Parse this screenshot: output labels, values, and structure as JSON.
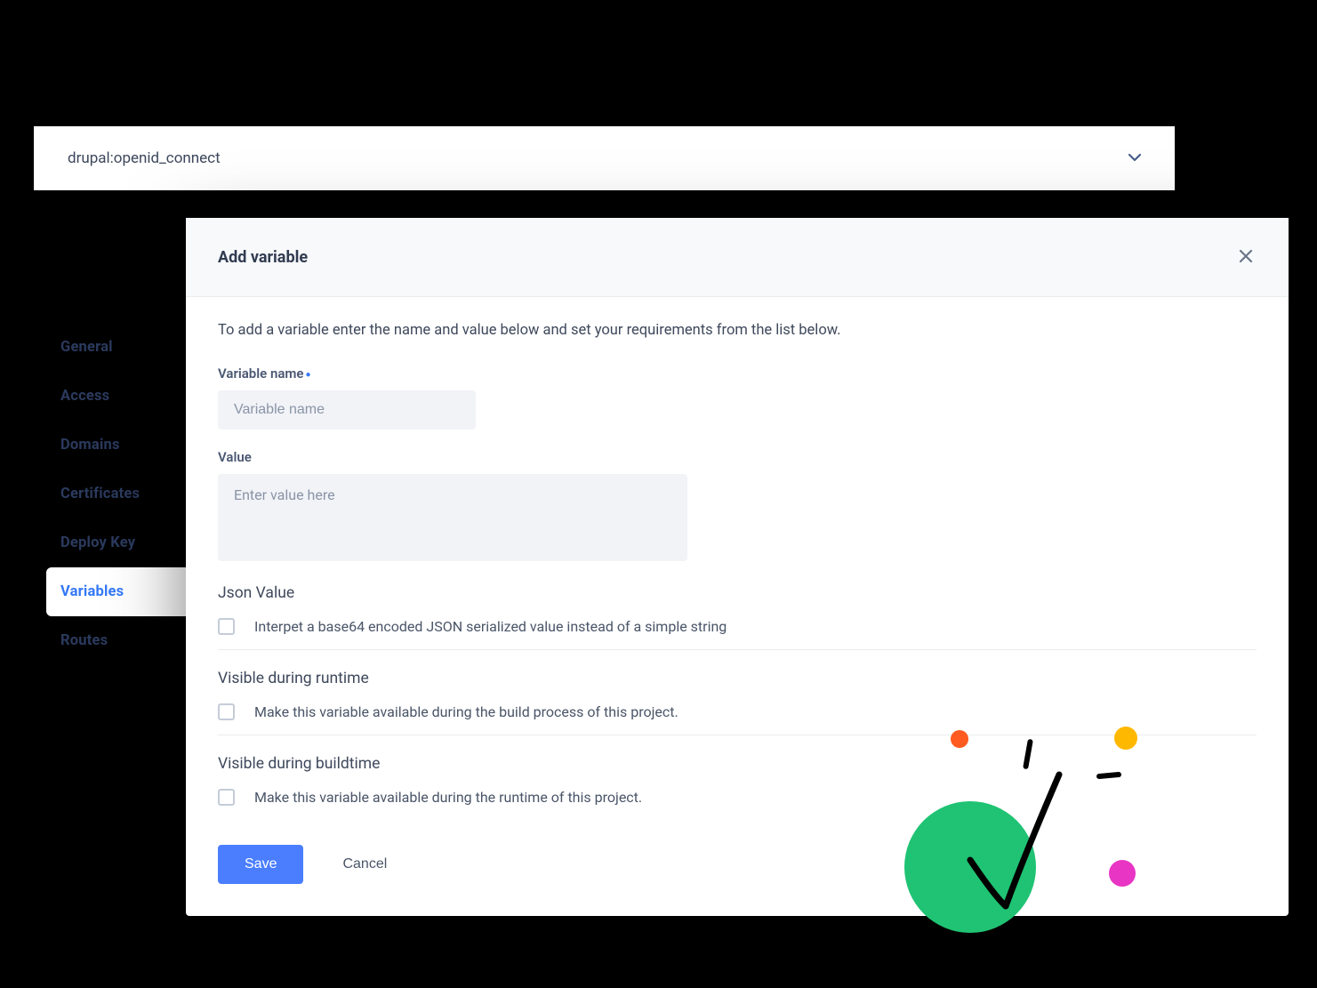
{
  "dropdown": {
    "value": "drupal:openid_connect"
  },
  "sidebar": {
    "items": [
      {
        "label": "General",
        "active": false
      },
      {
        "label": "Access",
        "active": false
      },
      {
        "label": "Domains",
        "active": false
      },
      {
        "label": "Certificates",
        "active": false
      },
      {
        "label": "Deploy Key",
        "active": false
      },
      {
        "label": "Variables",
        "active": true
      },
      {
        "label": "Routes",
        "active": false
      }
    ]
  },
  "modal": {
    "title": "Add variable",
    "intro": "To add a variable enter the name and value below and set your requirements from the list below.",
    "variable_name_label": "Variable name",
    "variable_name_placeholder": "Variable name",
    "value_label": "Value",
    "value_placeholder": "Enter value here",
    "json_section_title": "Json Value",
    "json_checkbox_label": "Interpet a base64 encoded JSON serialized value instead of a simple string",
    "runtime_section_title": "Visible during runtime",
    "runtime_checkbox_label": "Make this variable available during the build process of this project.",
    "buildtime_section_title": "Visible during buildtime",
    "buildtime_checkbox_label": "Make this variable available during the runtime of this project.",
    "save_label": "Save",
    "cancel_label": "Cancel"
  }
}
